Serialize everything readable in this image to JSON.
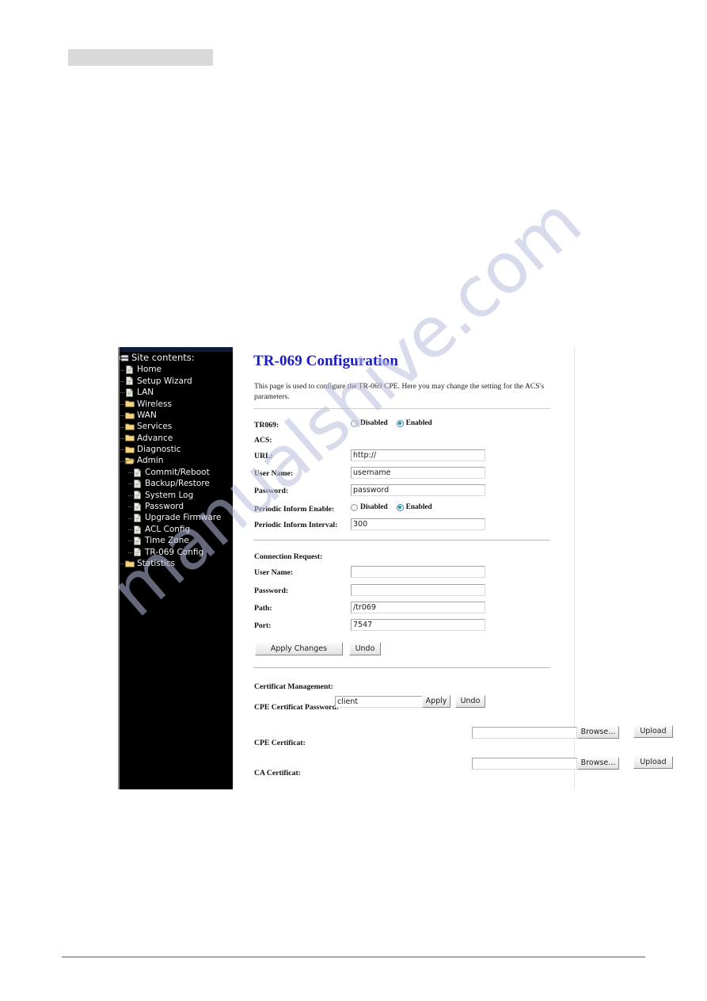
{
  "page": {
    "top_bar_placeholder": "",
    "watermark": "manualshive.com"
  },
  "sidebar": {
    "root": {
      "label": "Site contents:",
      "icon": "tree-root-icon"
    },
    "items": [
      {
        "label": "Home",
        "icon": "document-icon",
        "depth": 1,
        "type": "page"
      },
      {
        "label": "Setup Wizard",
        "icon": "document-icon",
        "depth": 1,
        "type": "page"
      },
      {
        "label": "LAN",
        "icon": "document-icon",
        "depth": 1,
        "type": "page"
      },
      {
        "label": "Wireless",
        "icon": "folder-icon",
        "depth": 1,
        "type": "folder"
      },
      {
        "label": "WAN",
        "icon": "folder-icon",
        "depth": 1,
        "type": "folder"
      },
      {
        "label": "Services",
        "icon": "folder-icon",
        "depth": 1,
        "type": "folder"
      },
      {
        "label": "Advance",
        "icon": "folder-icon",
        "depth": 1,
        "type": "folder"
      },
      {
        "label": "Diagnostic",
        "icon": "folder-icon",
        "depth": 1,
        "type": "folder"
      },
      {
        "label": "Admin",
        "icon": "folder-open-icon",
        "depth": 1,
        "type": "folder-open"
      },
      {
        "label": "Commit/Reboot",
        "icon": "document-icon",
        "depth": 2,
        "type": "page"
      },
      {
        "label": "Backup/Restore",
        "icon": "document-icon",
        "depth": 2,
        "type": "page"
      },
      {
        "label": "System Log",
        "icon": "document-icon",
        "depth": 2,
        "type": "page"
      },
      {
        "label": "Password",
        "icon": "document-icon",
        "depth": 2,
        "type": "page"
      },
      {
        "label": "Upgrade Firmware",
        "icon": "document-icon",
        "depth": 2,
        "type": "page"
      },
      {
        "label": "ACL Config",
        "icon": "document-icon",
        "depth": 2,
        "type": "page"
      },
      {
        "label": "Time Zone",
        "icon": "document-icon",
        "depth": 2,
        "type": "page"
      },
      {
        "label": "TR-069 Config",
        "icon": "document-icon",
        "depth": 2,
        "type": "page"
      },
      {
        "label": "Statistics",
        "icon": "folder-icon",
        "depth": 1,
        "type": "folder"
      }
    ]
  },
  "main": {
    "title": "TR-069 Configuration",
    "description": "This page is used to configure the TR-069 CPE. Here you may change the setting for the ACS's parameters.",
    "acs": {
      "tr069_label": "TR069:",
      "tr069_options": [
        {
          "label": "Disabled",
          "selected": false
        },
        {
          "label": "Enabled",
          "selected": true
        }
      ],
      "acs_heading": "ACS:",
      "url_label": "URL:",
      "url_value": "http://",
      "username_label": "User Name:",
      "username_value": "username",
      "password_label": "Password:",
      "password_value": "password",
      "periodic_inform_enable_label": "Periodic Inform Enable:",
      "periodic_inform_options": [
        {
          "label": "Disabled",
          "selected": false
        },
        {
          "label": "Enabled",
          "selected": true
        }
      ],
      "periodic_inform_interval_label": "Periodic Inform Interval:",
      "periodic_inform_interval_value": "300"
    },
    "connection_request": {
      "heading": "Connection Request:",
      "username_label": "User Name:",
      "username_value": "",
      "password_label": "Password:",
      "password_value": "",
      "path_label": "Path:",
      "path_value": "/tr069",
      "port_label": "Port:",
      "port_value": "7547",
      "apply_changes_label": "Apply Changes",
      "undo_label": "Undo"
    },
    "certificate_management": {
      "heading": "Certificat Management:",
      "cpe_password_label": "CPE Certificat Password:",
      "cpe_password_value": "client",
      "apply_label": "Apply",
      "undo_label": "Undo",
      "cpe_cert_label": "CPE Certificat:",
      "cpe_cert_value": "",
      "ca_cert_label": "CA Certificat:",
      "ca_cert_value": "",
      "browse_label": "Browse...",
      "upload_label": "Upload"
    }
  },
  "colors": {
    "title_blue": "#1b1bc4",
    "sidebar_bg": "#000000",
    "folder_yellow": "#f5d77a",
    "radio_accent": "#1a8fa8",
    "watermark": "#b9bede"
  }
}
